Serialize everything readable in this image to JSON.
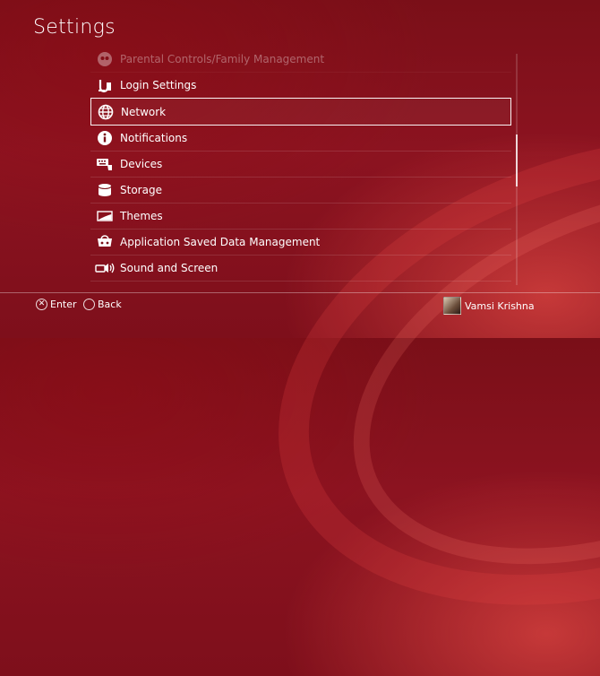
{
  "header": {
    "title": "Settings"
  },
  "menu": {
    "items": [
      {
        "label": "Parental Controls/Family Management",
        "icon": "family-icon"
      },
      {
        "label": "Login Settings",
        "icon": "login-icon"
      },
      {
        "label": "Network",
        "icon": "globe-icon"
      },
      {
        "label": "Notifications",
        "icon": "info-icon"
      },
      {
        "label": "Devices",
        "icon": "keyboard-icon"
      },
      {
        "label": "Storage",
        "icon": "storage-icon"
      },
      {
        "label": "Themes",
        "icon": "themes-icon"
      },
      {
        "label": "Application Saved Data Management",
        "icon": "saved-data-icon"
      },
      {
        "label": "Sound and Screen",
        "icon": "sound-screen-icon"
      }
    ],
    "selected": "Network"
  },
  "footer": {
    "enter_label": "Enter",
    "back_label": "Back",
    "user_name": "Vamsi Krishna"
  }
}
